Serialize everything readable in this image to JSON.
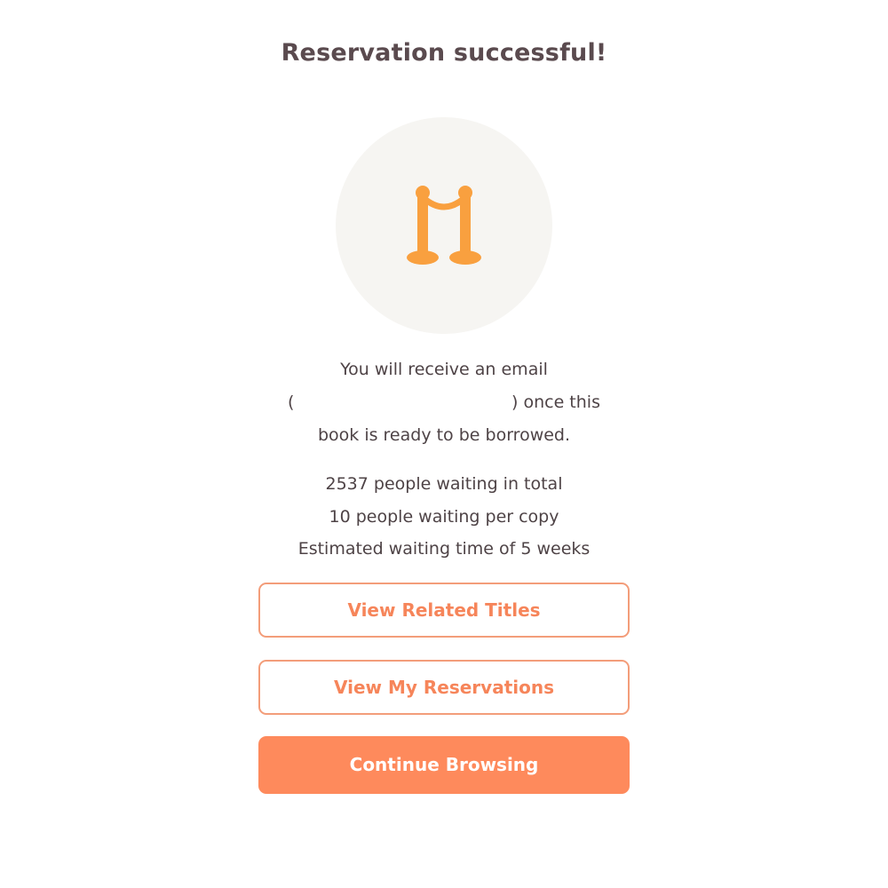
{
  "page": {
    "title": "Reservation successful!"
  },
  "illustration": {
    "icon": "queue-stanchion-icon",
    "circle_color": "#f6f5f2",
    "icon_color": "#f9a03f"
  },
  "message": {
    "line1": "You will receive an email",
    "paren_open": "(",
    "email": "",
    "after_email": ") once this",
    "line3": "book is ready to be borrowed."
  },
  "stats": {
    "total_waiting": "2537 people waiting in total",
    "per_copy": "10 people waiting per copy",
    "estimated_time": "Estimated waiting time of 5 weeks"
  },
  "buttons": {
    "related_titles": "View Related Titles",
    "my_reservations": "View My Reservations",
    "continue_browsing": "Continue Browsing"
  },
  "colors": {
    "accent": "#fe8a5c",
    "accent_text": "#f6855a",
    "outline_border": "#f39d7a",
    "text": "#4e4346",
    "title_text": "#5a4a4e"
  }
}
